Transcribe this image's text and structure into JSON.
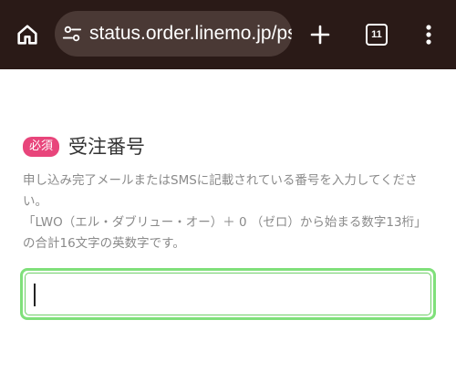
{
  "browser": {
    "url": "status.order.linemo.jp/ps",
    "tab_count": "11",
    "icons": {
      "home": "home-icon",
      "site_settings": "tune-icon",
      "new_tab": "plus-icon",
      "tabs": "tab-switcher-icon",
      "menu": "more-vert-icon"
    },
    "colors": {
      "toolbar_bg": "#2a1a17",
      "urlbar_bg": "#4a3935"
    }
  },
  "form": {
    "required_badge": "必須",
    "field_label": "受注番号",
    "help_line1": "申し込み完了メールまたはSMSに記載されている番号を入力してください。",
    "help_line2": "「LWO（エル・ダブリュー・オー）＋ 0 （ゼロ）から始まる数字13桁」の合計16文字の英数字です。",
    "input_value": "",
    "colors": {
      "badge": "#e8457b",
      "focus_ring": "#7fe07a"
    }
  }
}
